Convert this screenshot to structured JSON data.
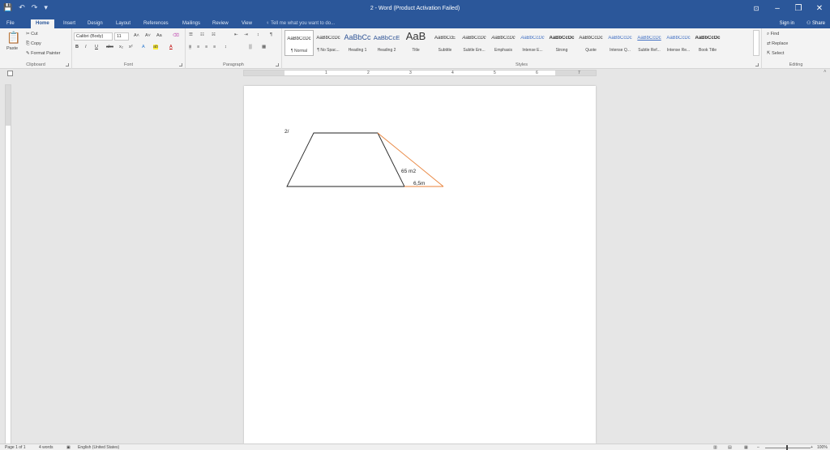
{
  "window": {
    "title": "2 - Word (Product Activation Failed)",
    "ribbon_options_glyph": "⊡",
    "minimize_glyph": "–",
    "restore_glyph": "❐",
    "close_glyph": "✕"
  },
  "qat": {
    "save_glyph": "💾",
    "undo_glyph": "↶",
    "redo_glyph": "↷",
    "more_glyph": "▾"
  },
  "tabs": [
    "File",
    "Home",
    "Insert",
    "Design",
    "Layout",
    "References",
    "Mailings",
    "Review",
    "View"
  ],
  "tell_me": "Tell me what you want to do...",
  "account": {
    "sign_in": "Sign in",
    "share": "Share"
  },
  "ribbon": {
    "clipboard": {
      "label": "Clipboard",
      "paste": "Paste",
      "cut": "Cut",
      "copy": "Copy",
      "format_painter": "Format Painter"
    },
    "font": {
      "label": "Font",
      "font_name": "Calibri (Body)",
      "font_size": "11",
      "bold": "B",
      "italic": "I",
      "underline": "U",
      "strike": "abc",
      "sub": "x₂",
      "sup": "x²",
      "grow": "A˄",
      "shrink": "A˅",
      "case": "Aa",
      "clear": "⌫",
      "effects": "A",
      "highlight": "ab",
      "color": "A"
    },
    "paragraph": {
      "label": "Paragraph",
      "bullets": "☰",
      "numbering": "☷",
      "multilevel": "☵",
      "dec_indent": "⇤",
      "inc_indent": "⇥",
      "sort": "↕",
      "pilcrow": "¶",
      "align_left": "≡",
      "center": "≡",
      "align_right": "≡",
      "justify": "≡",
      "spacing": "↕",
      "shading": "▒",
      "borders": "▦"
    },
    "styles": {
      "label": "Styles",
      "items": [
        {
          "sample": "AaBbCcDc",
          "name": "¶ Normal"
        },
        {
          "sample": "AaBbCcDc",
          "name": "¶ No Spac..."
        },
        {
          "sample": "AaBbCc",
          "name": "Heading 1"
        },
        {
          "sample": "AaBbCcE",
          "name": "Heading 2"
        },
        {
          "sample": "AaB",
          "name": "Title"
        },
        {
          "sample": "AaBbCcE",
          "name": "Subtitle"
        },
        {
          "sample": "AaBbCcDc",
          "name": "Subtle Em..."
        },
        {
          "sample": "AaBbCcDc",
          "name": "Emphasis"
        },
        {
          "sample": "AaBbCcDc",
          "name": "Intense E..."
        },
        {
          "sample": "AaBbCcDc",
          "name": "Strong"
        },
        {
          "sample": "AaBbCcDc",
          "name": "Quote"
        },
        {
          "sample": "AaBbCcDc",
          "name": "Intense Q..."
        },
        {
          "sample": "AaBbCcDc",
          "name": "Subtle Ref..."
        },
        {
          "sample": "AaBbCcDc",
          "name": "Intense Re..."
        },
        {
          "sample": "AaBbCcDc",
          "name": "Book Title"
        }
      ]
    },
    "editing": {
      "label": "Editing",
      "find": "Find",
      "replace": "Replace",
      "select": "Select"
    }
  },
  "ruler": {
    "numbers": [
      "1",
      "2",
      "3",
      "4",
      "5",
      "6",
      "7"
    ]
  },
  "document": {
    "label_number": "2/",
    "area_label": "65 m2",
    "length_label": "6,5m"
  },
  "statusbar": {
    "page": "Page 1 of 1",
    "words": "4 words",
    "language": "English (United States)",
    "zoom": "100%"
  },
  "colors": {
    "brand": "#2b579a",
    "shape_line": "#222222",
    "accent_line": "#e8823a"
  }
}
